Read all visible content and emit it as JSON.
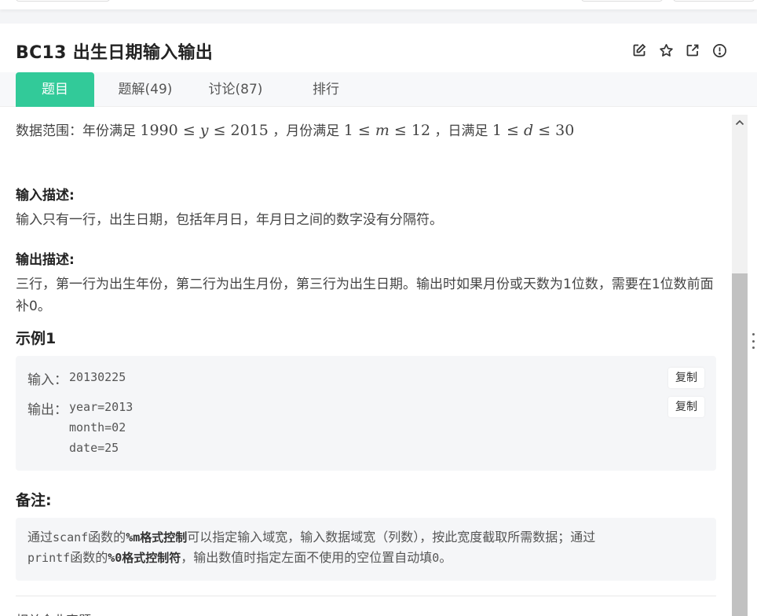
{
  "problem": {
    "title": "BC13  出生日期输入输出",
    "icons": [
      "edit-icon",
      "star-icon",
      "external-link-icon",
      "report-icon"
    ]
  },
  "tabs": [
    {
      "label": "题目",
      "active": true
    },
    {
      "label": "题解(49)",
      "active": false
    },
    {
      "label": "讨论(87)",
      "active": false
    },
    {
      "label": "排行",
      "active": false
    }
  ],
  "content": {
    "range": {
      "prefix": "数据范围：年份满足",
      "year_min": "1990",
      "year_var": "y",
      "year_max": "2015",
      "mid1": "，月份满足",
      "month_min": "1",
      "month_var": "m",
      "month_max": "12",
      "mid2": "，日满足",
      "day_min": "1",
      "day_var": "d",
      "day_max": "30",
      "leq": "≤"
    },
    "input_heading": "输入描述:",
    "input_text": "输入只有一行，出生日期，包括年月日，年月日之间的数字没有分隔符。",
    "output_heading": "输出描述:",
    "output_text": "三行，第一行为出生年份，第二行为出生月份，第三行为出生日期。输出时如果月份或天数为1位数，需要在1位数前面补0。",
    "sample_heading": "示例1",
    "sample": {
      "input_label": "输入：",
      "input_value": "20130225",
      "output_label": "输出：",
      "output_lines": [
        "year=2013",
        "month=02",
        "date=25"
      ],
      "copy_label": "复制"
    },
    "note_heading": "备注:",
    "note": {
      "p1": "通过",
      "scanf": "scanf",
      "p2": "函数的",
      "fmt1": "%m格式控制",
      "p3": "可以指定输入域宽，输入数据域宽（列数），按此宽度截取所需数据；通过",
      "printf": "printf",
      "p4": "函数的",
      "fmt2": "%0格式控制符",
      "p5": "，输出数值时指定左面不使用的空位置自动填",
      "zero": "0",
      "p6": "。"
    },
    "cut_text": "相关企业真题"
  }
}
